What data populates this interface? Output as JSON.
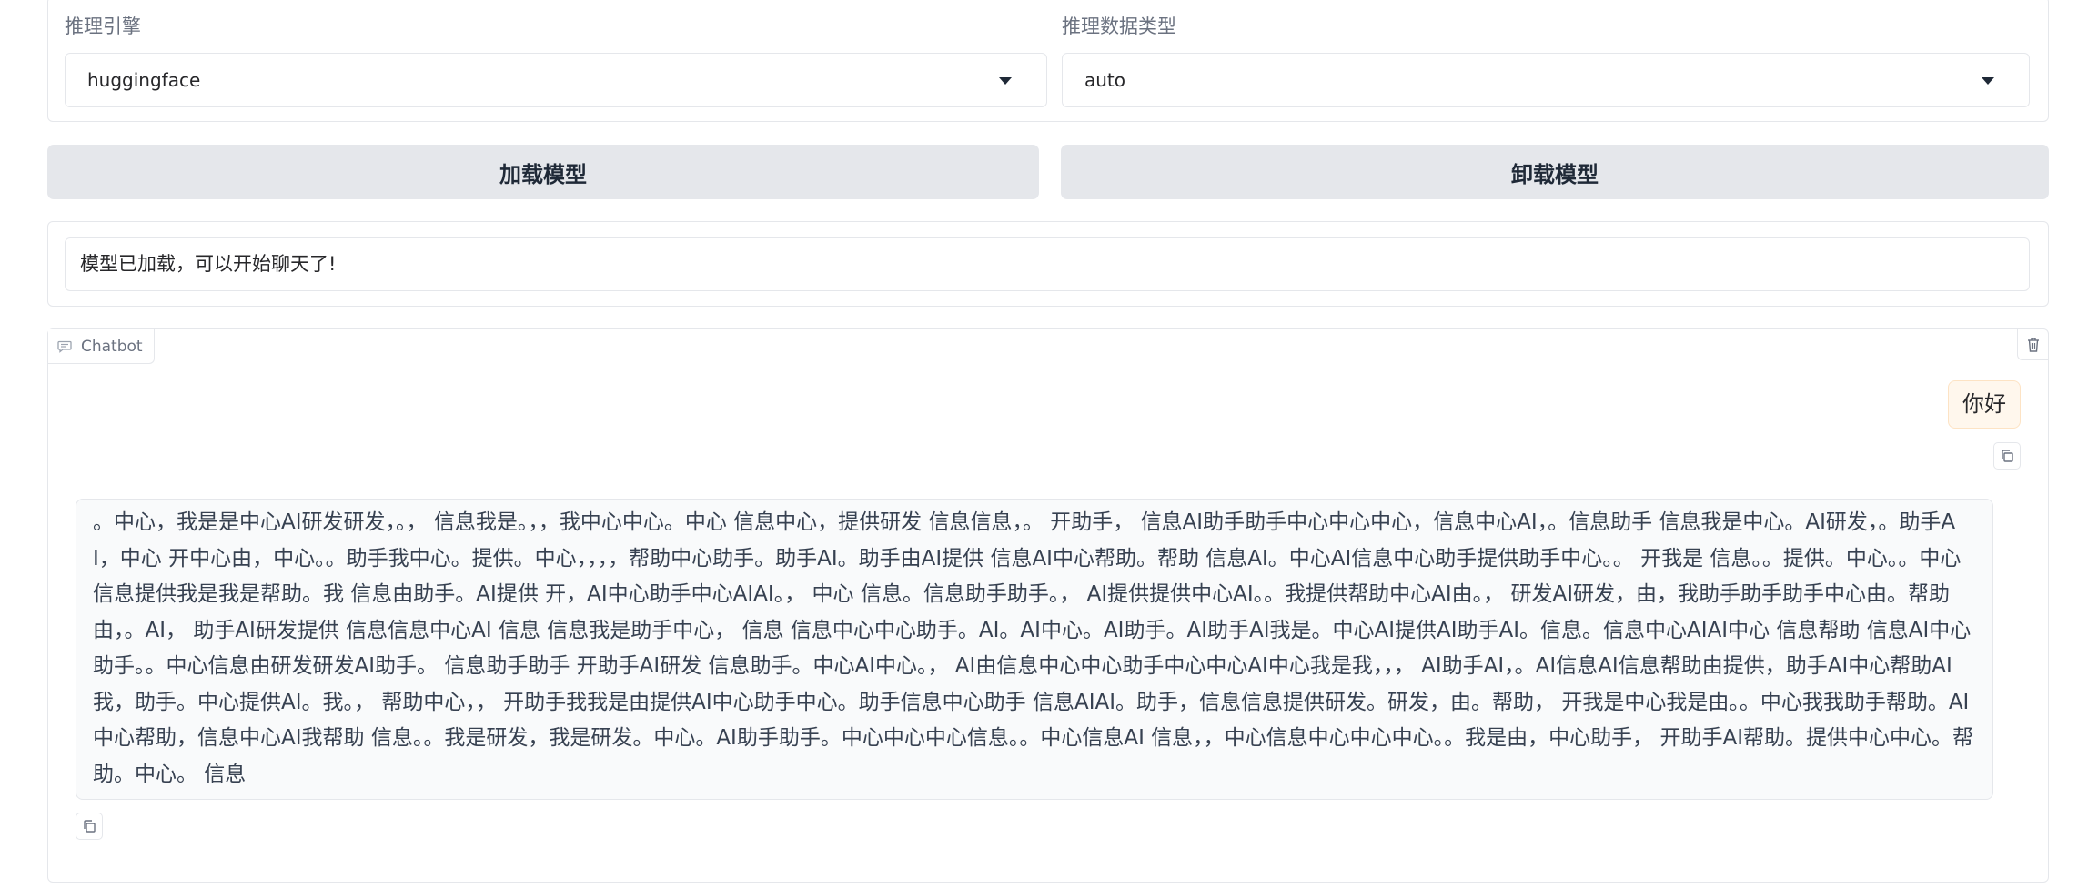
{
  "engine": {
    "label": "推理引擎",
    "value": "huggingface"
  },
  "dtype": {
    "label": "推理数据类型",
    "value": "auto"
  },
  "buttons": {
    "load": "加载模型",
    "unload": "卸载模型"
  },
  "status": {
    "text": "模型已加载，可以开始聊天了!"
  },
  "chatbot": {
    "label": "Chatbot",
    "messages": [
      {
        "role": "user",
        "text": "你好"
      },
      {
        "role": "assistant",
        "text": "。中心，我是是中心AI研发研发，。，  信息我是。，，我中心中心。中心 信息中心，提供研发 信息信息，。 开助手，  信息AI助手助手中心中心中心，信息中心AI，。信息助手 信息我是中心。AI研发，。助手AI，中心 开中心由，中心。。助手我中心。提供。中心，，，，帮助中心助手。助手AI。助手由AI提供 信息AI中心帮助。帮助 信息AI。中心AI信息中心助手提供助手中心。。 开我是 信息。。提供。中心。。中心 信息提供我是我是帮助。我 信息由助手。AI提供 开，AI中心助手中心AIAI。，  中心 信息。信息助手助手。，  AI提供提供中心AI。。我提供帮助中心AI由。，  研发AI研发，由，我助手助手助手中心由。帮助由，。AI，  助手AI研发提供 信息信息中心AI 信息 信息我是助手中心，  信息 信息中心中心助手。AI。AI中心。AI助手。AI助手AI我是。中心AI提供AI助手AI。信息。信息中心AIAI中心 信息帮助 信息AI中心助手。。中心信息由研发研发AI助手。 信息助手助手 开助手AI研发 信息助手。中心AI中心。，  AI由信息中心中心助手中心中心AI中心我是我，，，  AI助手AI，。AI信息AI信息帮助由提供，助手AI中心帮助AI我，助手。中心提供AI。我。，  帮助中心，，  开助手我我是由提供AI中心助手中心。助手信息中心助手 信息AIAI。助手，信息信息提供研发。研发，由。帮助，  开我是中心我是由。。中心我我助手帮助。AI中心帮助，信息中心AI我帮助 信息。。我是研发，我是研发。中心。AI助手助手。中心中心中心信息。。中心信息AI 信息，，中心信息中心中心中心。。我是由，中心助手，  开助手AI帮助。提供中心中心。帮助。中心。 信息"
      }
    ]
  },
  "icons": {
    "dropdown": "chevron-down-icon",
    "chat": "chat-bubble-icon",
    "trash": "trash-icon",
    "copy": "copy-icon"
  },
  "colors": {
    "border": "#e5e7eb",
    "button_bg": "#e5e7eb",
    "user_bubble_bg": "#fff7ed",
    "bot_bubble_bg": "#f9fafb"
  }
}
